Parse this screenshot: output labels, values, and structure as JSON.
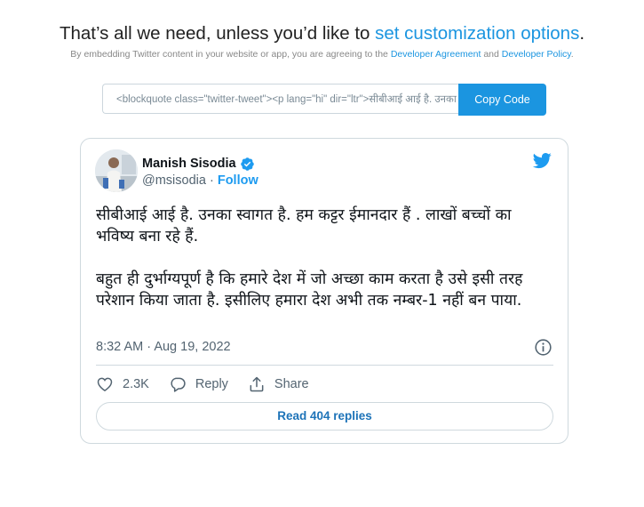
{
  "header": {
    "intro": "That’s all we need, unless you’d like to",
    "customize_link": "set customization options",
    "period": ".",
    "notice_prefix": "By embedding Twitter content in your website or app, you are agreeing to the",
    "developer_agreement": "Developer Agreement",
    "notice_and": "and",
    "developer_policy": "Developer Policy",
    "notice_period": "."
  },
  "embed": {
    "code": "<blockquote class=\"twitter-tweet\"><p lang=\"hi\" dir=\"ltr\">सीबीआई आई है. उनका स्वागत है.",
    "copy_label": "Copy Code"
  },
  "tweet": {
    "author_name": "Manish Sisodia",
    "handle": "@msisodia",
    "separator": "·",
    "follow_label": "Follow",
    "text_paragraph_1": "सीबीआई आई है. उनका स्वागत है. हम कट्टर ईमानदार हैं . लाखों बच्चों का भविष्य बना रहे हैं.",
    "text_paragraph_2": "बहुत ही दुर्भाग्यपूर्ण है कि हमारे देश में जो अच्छा काम करता है उसे इसी तरह परेशान किया जाता है. इसीलिए हमारा देश अभी तक नम्बर-1 नहीं बन पाया.",
    "time": "8:32 AM",
    "date": "Aug 19, 2022",
    "likes": "2.3K",
    "reply_label": "Reply",
    "share_label": "Share",
    "read_replies_label": "Read 404 replies"
  },
  "icons": {
    "verified": "verified-badge-icon",
    "twitter": "twitter-bird-icon",
    "info": "info-icon",
    "like": "heart-icon",
    "reply": "reply-bubble-icon",
    "share": "share-icon"
  },
  "colors": {
    "link": "#1b95e0",
    "twitter_blue": "#1d9bf0",
    "muted": "#536471",
    "border": "#cfd9de"
  }
}
